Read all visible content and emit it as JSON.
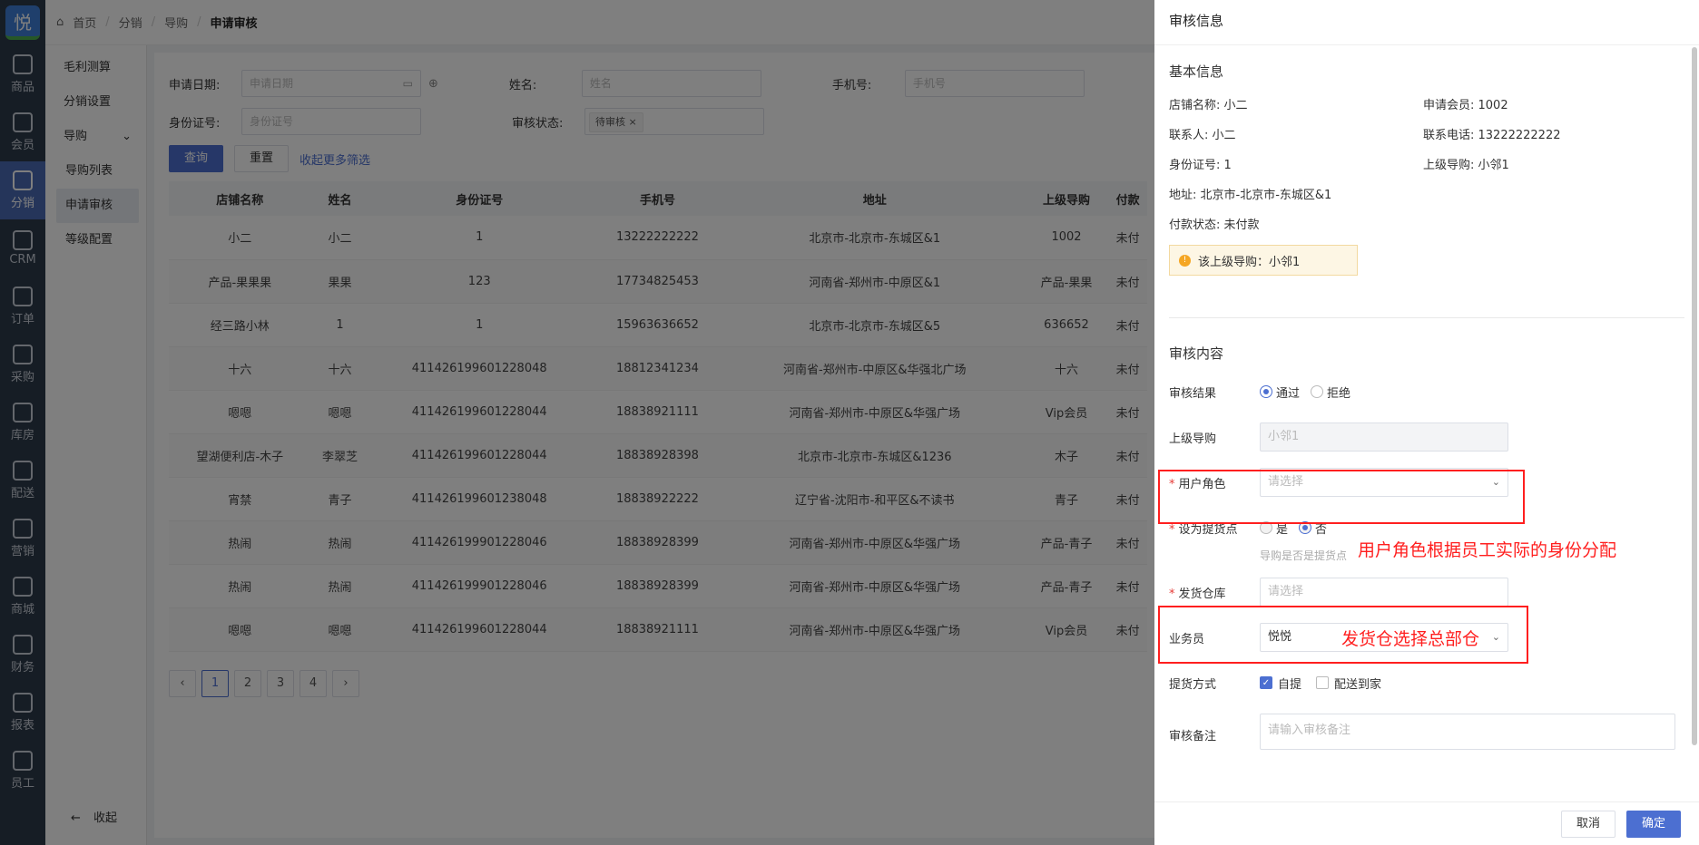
{
  "rail": {
    "logo": "悦",
    "items": [
      {
        "label": "商品",
        "icon": "box-icon"
      },
      {
        "label": "会员",
        "icon": "user-icon"
      },
      {
        "label": "分销",
        "icon": "network-icon"
      },
      {
        "label": "CRM",
        "icon": "crm-icon"
      },
      {
        "label": "订单",
        "icon": "order-icon"
      },
      {
        "label": "采购",
        "icon": "clipboard-icon"
      },
      {
        "label": "库房",
        "icon": "warehouse-icon"
      },
      {
        "label": "配送",
        "icon": "truck-icon"
      },
      {
        "label": "营销",
        "icon": "gift-icon"
      },
      {
        "label": "商城",
        "icon": "home-icon"
      },
      {
        "label": "财务",
        "icon": "yen-icon"
      },
      {
        "label": "报表",
        "icon": "chart-icon"
      },
      {
        "label": "员工",
        "icon": "staff-icon"
      }
    ]
  },
  "subnav": {
    "items": [
      "毛利测算",
      "分销设置"
    ],
    "group": "导购",
    "children": [
      "导购列表",
      "申请审核",
      "等级配置"
    ],
    "collapse": "收起"
  },
  "breadcrumb": [
    "首页",
    "分销",
    "导购",
    "申请审核"
  ],
  "filters": {
    "date_label": "申请日期:",
    "date_ph": "申请日期",
    "name_label": "姓名:",
    "name_ph": "姓名",
    "phone_label": "手机号:",
    "phone_ph": "手机号",
    "id_label": "身份证号:",
    "id_ph": "身份证号",
    "status_label": "审核状态:",
    "status_tag": "待审核",
    "query": "查询",
    "reset": "重置",
    "more": "收起更多筛选"
  },
  "table": {
    "headers": [
      "店铺名称",
      "姓名",
      "身份证号",
      "手机号",
      "地址",
      "上级导购",
      "付款"
    ],
    "rows": [
      [
        "小二",
        "小二",
        "1",
        "13222222222",
        "北京市-北京市-东城区&1",
        "1002",
        "未付"
      ],
      [
        "产品-果果果",
        "果果",
        "123",
        "17734825453",
        "河南省-郑州市-中原区&1",
        "产品-果果",
        "未付"
      ],
      [
        "经三路小林",
        "1",
        "1",
        "15963636652",
        "北京市-北京市-东城区&5",
        "636652",
        "未付"
      ],
      [
        "十六",
        "十六",
        "411426199601228048",
        "18812341234",
        "河南省-郑州市-中原区&华强北广场",
        "十六",
        "未付"
      ],
      [
        "嗯嗯",
        "嗯嗯",
        "411426199601228044",
        "18838921111",
        "河南省-郑州市-中原区&华强广场",
        "Vip会员",
        "未付"
      ],
      [
        "望湖便利店-木子",
        "李翠芝",
        "411426199601228044",
        "18838928398",
        "北京市-北京市-东城区&1236",
        "木子",
        "未付"
      ],
      [
        "宵禁",
        "青子",
        "411426199601238048",
        "18838922222",
        "辽宁省-沈阳市-和平区&不读书",
        "青子",
        "未付"
      ],
      [
        "热闹",
        "热闹",
        "411426199901228046",
        "18838928399",
        "河南省-郑州市-中原区&华强广场",
        "产品-青子",
        "未付"
      ],
      [
        "热闹",
        "热闹",
        "411426199901228046",
        "18838928399",
        "河南省-郑州市-中原区&华强广场",
        "产品-青子",
        "未付"
      ],
      [
        "嗯嗯",
        "嗯嗯",
        "411426199601228044",
        "18838921111",
        "河南省-郑州市-中原区&华强广场",
        "Vip会员",
        "未付"
      ]
    ]
  },
  "pager": {
    "prev": "‹",
    "pages": [
      "1",
      "2",
      "3",
      "4"
    ],
    "next": "›"
  },
  "drawer": {
    "title": "审核信息",
    "basic_title": "基本信息",
    "info": [
      "店铺名称: 小二",
      "申请会员: 1002",
      "联系人: 小二",
      "联系电话: 13222222222",
      "身份证号: 1",
      "上级导购: 小邻1",
      "地址: 北京市-北京市-东城区&1",
      "",
      "付款状态: 未付款",
      ""
    ],
    "alert": "该上级导购：小邻1",
    "content_title": "审核内容",
    "result_label": "审核结果",
    "result_pass": "通过",
    "result_reject": "拒绝",
    "parent_label": "上级导购",
    "parent_value": "小邻1",
    "role_label": "用户角色",
    "role_ph": "请选择",
    "pickup_label": "设为提货点",
    "pickup_yes": "是",
    "pickup_no": "否",
    "pickup_hint": "导购是否是提货点",
    "warehouse_label": "发货仓库",
    "warehouse_ph": "请选择",
    "sales_label": "业务员",
    "sales_value": "悦悦",
    "method_label": "提货方式",
    "method_self": "自提",
    "method_delivery": "配送到家",
    "remark_label": "审核备注",
    "remark_ph": "请输入审核备注",
    "cancel": "取消",
    "confirm": "确定"
  },
  "annotations": {
    "role": "用户角色根据员工实际的身份分配",
    "warehouse": "发货仓选择总部仓"
  }
}
